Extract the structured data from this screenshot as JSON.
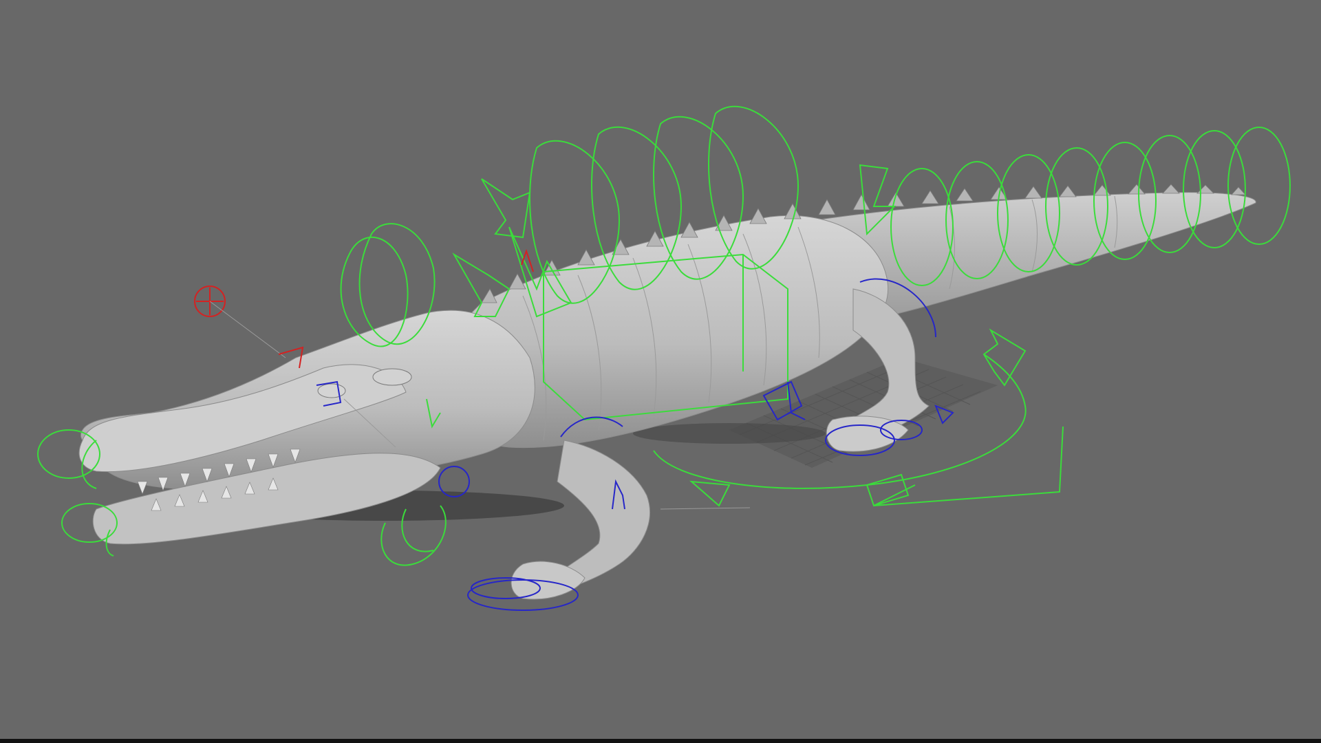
{
  "viewport": {
    "background": "#686868",
    "shading": "smooth-shade-gray",
    "model": "alligator-mesh",
    "model_color": "#c4c4c4",
    "controls": {
      "fk_control_color": "#3bdc3b",
      "ik_control_color": "#2626c8",
      "aim_control_color": "#d42222"
    }
  }
}
